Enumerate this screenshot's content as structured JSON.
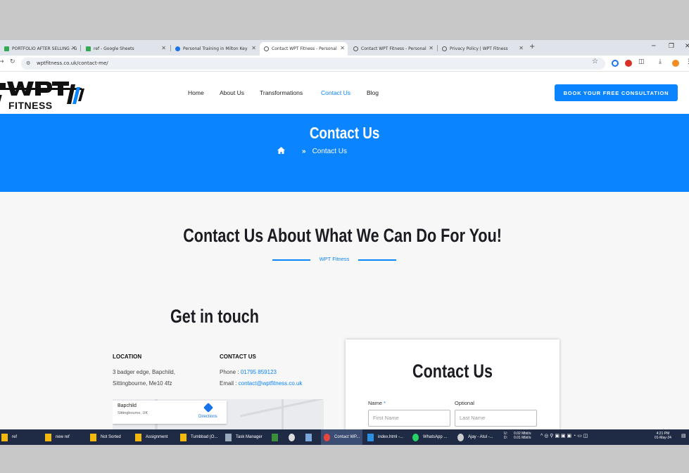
{
  "browser": {
    "tabs": [
      {
        "title": "PORTFOLIO AFTER SELLING - G",
        "icon_color": "#34a853"
      },
      {
        "title": "ref - Google Sheets",
        "icon_color": "#34a853"
      },
      {
        "title": "Personal Training in Milton Key",
        "icon_color": "#1a73e8"
      },
      {
        "title": "Contact WPT Fitness - Personal",
        "icon_color": "#555555"
      },
      {
        "title": "Contact WPT Fitness - Personal",
        "icon_color": "#555555"
      },
      {
        "title": "Privacy Policy | WPT Fitness",
        "icon_color": "#555555"
      }
    ],
    "active_tab_index": 3,
    "url": "wptfitness.co.uk/contact-me/"
  },
  "site": {
    "logo_text": "FITNESS",
    "nav": [
      "Home",
      "About Us",
      "Transformations",
      "Contact Us",
      "Blog"
    ],
    "active_nav": "Contact Us",
    "cta": "BOOK YOUR FREE CONSULTATION",
    "accent_color": "#0a84ff"
  },
  "hero": {
    "title": "Contact Us",
    "breadcrumb_current": "Contact Us"
  },
  "main": {
    "section_title": "Contact Us About What We Can Do For You!",
    "divider_label": "WPT Fitness",
    "get_in_touch": "Get in touch",
    "location": {
      "heading": "LOCATION",
      "line1": "3 badger edge, Bapchild,",
      "line2": "Sittingbourne, Me10 4fz"
    },
    "contact": {
      "heading": "CONTACT US",
      "phone_label": "Phone : ",
      "phone": "01795 859123",
      "email_label": "Email : ",
      "email": "contact@wptfitness.co.uk"
    },
    "map": {
      "place": "Bapchild",
      "sub": "Sittingbourne, UK",
      "directions": "Directions"
    },
    "form": {
      "title": "Contact Us",
      "name_label": "Name",
      "required_mark": "*",
      "optional_label": "Optional",
      "first_placeholder": "First Name",
      "last_placeholder": "Last Name"
    }
  },
  "taskbar": {
    "items": [
      "ref",
      "new ref",
      "Not Sorted",
      "Assignment",
      "Tumbbad (O...",
      "Task Manager",
      "Contact WP...",
      "index.html -...",
      "WhatsApp ...",
      "Ajay - Atul -..."
    ],
    "net_up": "0.02 Mbit/s",
    "net_down": "0.01 Mbit/s",
    "time": "4:21 PM",
    "date": "01-May-24"
  }
}
